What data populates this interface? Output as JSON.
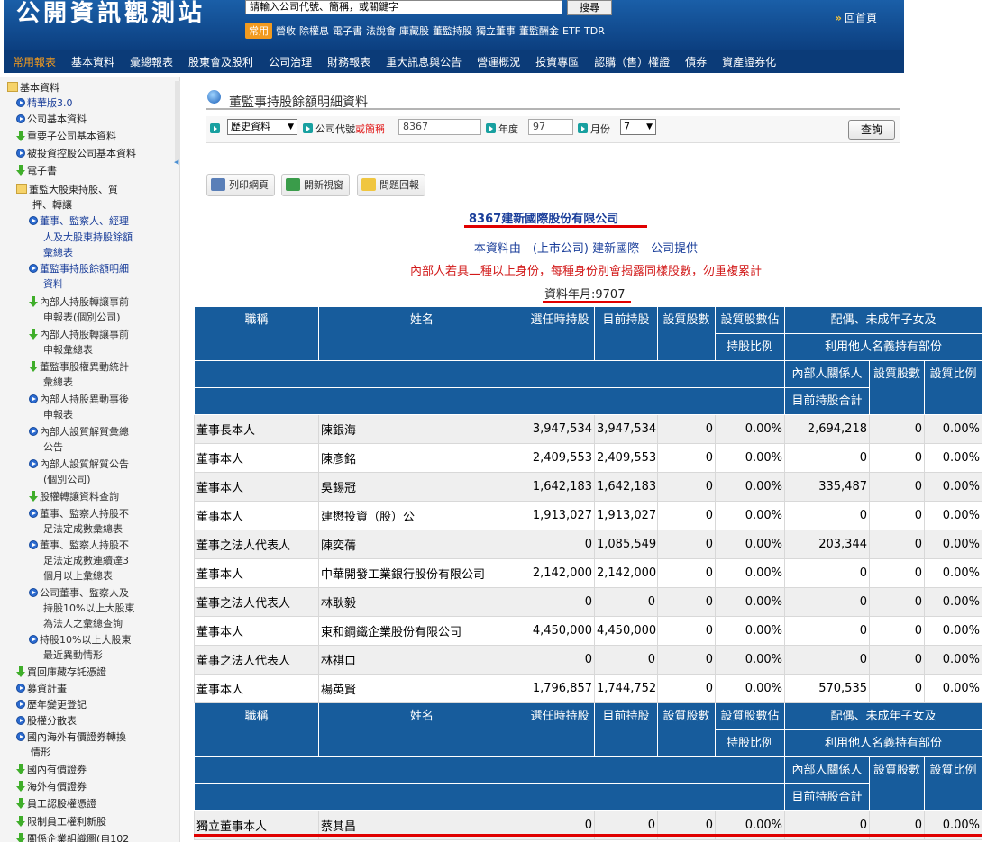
{
  "header": {
    "logo": "公開資訊觀測站",
    "search_placeholder": "請輸入公司代號、簡稱，或關鍵字",
    "search_button": "搜尋",
    "quick_badge": "常用",
    "quick_links": [
      "營收",
      "除權息",
      "電子書",
      "法說會",
      "庫藏股",
      "董監持股",
      "獨立董事",
      "董監酬金",
      "ETF",
      "TDR"
    ],
    "home_arrows": "»",
    "home_label": "回首頁"
  },
  "nav": [
    "常用報表",
    "基本資料",
    "彙總報表",
    "股東會及股利",
    "公司治理",
    "財務報表",
    "重大訊息與公告",
    "營運概況",
    "投資專區",
    "認購（售）權證",
    "債券",
    "資產證券化"
  ],
  "sidebar": {
    "items": [
      "基本資料",
      "精華版3.0",
      "公司基本資料",
      "重要子公司基本資料",
      "被投資控股公司基本資料",
      "電子書",
      "董監大股東持股、質",
      "押、轉讓",
      "董事、監察人、經理",
      "人及大股東持股餘額",
      "彙總表",
      "董監事持股餘額明細",
      "資料",
      "內部人持股轉讓事前",
      "申報表(個別公司)",
      "內部人持股轉讓事前",
      "申報彙總表",
      "董監事股權異動統計",
      "彙總表",
      "內部人持股異動事後",
      "申報表",
      "內部人設質解質彙總",
      "公告",
      "內部人設質解質公告",
      "(個別公司)",
      "股權轉讓資料查詢",
      "董事、監察人持股不",
      "足法定成數彙總表",
      "董事、監察人持股不",
      "足法定成數連續達3",
      "個月以上彙總表",
      "公司董事、監察人及",
      "持股10%以上大股東",
      "為法人之彙總查詢",
      "持股10%以上大股東",
      "最近異動情形",
      "買回庫藏存託憑證",
      "募資計畫",
      "歷年變更登記",
      "股權分散表",
      "國內海外有價證券轉換",
      "情形",
      "國內有價證券",
      "海外有價證券",
      "員工認股權憑證",
      "限制員工權利新股",
      "關係企業組織圖(自102"
    ]
  },
  "page_title": "董監事持股餘額明細資料",
  "query": {
    "history_select": "歷史資料",
    "company_label": "公司代號",
    "company_label_or": "或",
    "company_label_abbr": "簡稱",
    "company_value": "8367",
    "year_label": "年度",
    "year_value": "97",
    "month_label": "月份",
    "month_value": "7",
    "query_button": "查詢"
  },
  "tools": {
    "print": "列印網頁",
    "new_window": "開新視窗",
    "feedback": "問題回報"
  },
  "company": {
    "code": "8367",
    "name": "建新國際股份有限公司",
    "provided_by": "本資料由　(上市公司) 建新國際　公司提供",
    "note": "內部人若具二種以上身份，每種身份別會揭露同樣股數，勿重複累計",
    "data_date": "資料年月:9707"
  },
  "table": {
    "headers": {
      "title": "職稱",
      "name": "姓名",
      "elected": "選任時持股",
      "current": "目前持股",
      "pledged": "設質股數",
      "pledged_ratio_1": "設質股數佔",
      "pledged_ratio_2": "持股比例",
      "spouse_1": "配偶、未成年子女及",
      "spouse_2": "利用他人名義持有部份",
      "related_1": "內部人關係人",
      "related_2": "目前持股合計",
      "sp_pledged": "設質股數",
      "sp_ratio": "設質比例"
    },
    "rows": [
      {
        "title": "董事長本人",
        "name": "陳銀海",
        "elected": "3,947,534",
        "current": "3,947,534",
        "pledged": "0",
        "ratio": "0.00%",
        "related": "2,694,218",
        "sp_pledged": "0",
        "sp_ratio": "0.00%"
      },
      {
        "title": "董事本人",
        "name": "陳彥銘",
        "elected": "2,409,553",
        "current": "2,409,553",
        "pledged": "0",
        "ratio": "0.00%",
        "related": "0",
        "sp_pledged": "0",
        "sp_ratio": "0.00%"
      },
      {
        "title": "董事本人",
        "name": "吳錫冠",
        "elected": "1,642,183",
        "current": "1,642,183",
        "pledged": "0",
        "ratio": "0.00%",
        "related": "335,487",
        "sp_pledged": "0",
        "sp_ratio": "0.00%"
      },
      {
        "title": "董事本人",
        "name": "建懋投資（股）公",
        "elected": "1,913,027",
        "current": "1,913,027",
        "pledged": "0",
        "ratio": "0.00%",
        "related": "0",
        "sp_pledged": "0",
        "sp_ratio": "0.00%"
      },
      {
        "title": "董事之法人代表人",
        "name": "陳奕蒨",
        "elected": "0",
        "current": "1,085,549",
        "pledged": "0",
        "ratio": "0.00%",
        "related": "203,344",
        "sp_pledged": "0",
        "sp_ratio": "0.00%"
      },
      {
        "title": "董事本人",
        "name": "中華開發工業銀行股份有限公司",
        "elected": "2,142,000",
        "current": "2,142,000",
        "pledged": "0",
        "ratio": "0.00%",
        "related": "0",
        "sp_pledged": "0",
        "sp_ratio": "0.00%"
      },
      {
        "title": "董事之法人代表人",
        "name": "林耿毅",
        "elected": "0",
        "current": "0",
        "pledged": "0",
        "ratio": "0.00%",
        "related": "0",
        "sp_pledged": "0",
        "sp_ratio": "0.00%"
      },
      {
        "title": "董事本人",
        "name": "東和鋼鐵企業股份有限公司",
        "elected": "4,450,000",
        "current": "4,450,000",
        "pledged": "0",
        "ratio": "0.00%",
        "related": "0",
        "sp_pledged": "0",
        "sp_ratio": "0.00%"
      },
      {
        "title": "董事之法人代表人",
        "name": "林祺ロ",
        "elected": "0",
        "current": "0",
        "pledged": "0",
        "ratio": "0.00%",
        "related": "0",
        "sp_pledged": "0",
        "sp_ratio": "0.00%"
      },
      {
        "title": "董事本人",
        "name": "楊英賢",
        "elected": "1,796,857",
        "current": "1,744,752",
        "pledged": "0",
        "ratio": "0.00%",
        "related": "570,535",
        "sp_pledged": "0",
        "sp_ratio": "0.00%"
      }
    ],
    "rows2": [
      {
        "title": "獨立董事本人",
        "name": "蔡其昌",
        "elected": "0",
        "current": "0",
        "pledged": "0",
        "ratio": "0.00%",
        "related": "0",
        "sp_pledged": "0",
        "sp_ratio": "0.00%"
      }
    ]
  }
}
